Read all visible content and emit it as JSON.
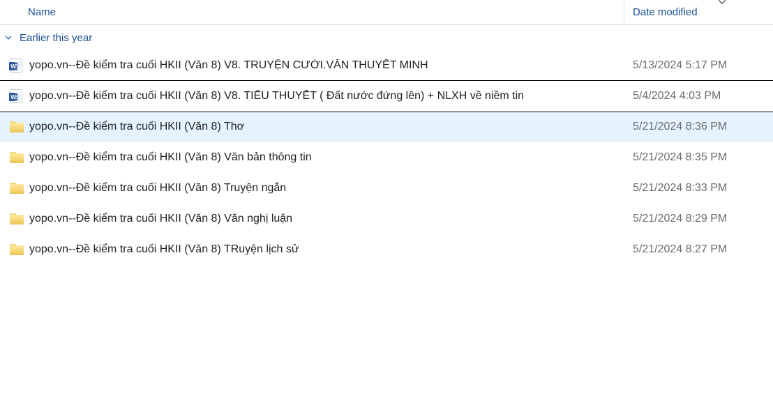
{
  "columns": {
    "name": "Name",
    "date": "Date modified"
  },
  "group": {
    "label": "Earlier this year"
  },
  "items": [
    {
      "type": "word",
      "name": "yopo.vn--Đề kiểm tra cuối HKII (Văn 8) V8.  TRUYỆN CƯỜI.VĂN THUYẾT MINH",
      "date": "5/13/2024 5:17 PM",
      "state": ""
    },
    {
      "type": "word",
      "name": "yopo.vn--Đề kiểm tra cuối HKII (Văn 8)  V8. TIỂU THUYẾT ( Đất nước đứng lên) + NLXH về niềm tin",
      "date": "5/4/2024 4:03 PM",
      "state": "selected"
    },
    {
      "type": "folder",
      "name": "yopo.vn--Đề kiểm tra cuối HKII (Văn 8)  Thơ",
      "date": "5/21/2024 8:36 PM",
      "state": "hover"
    },
    {
      "type": "folder",
      "name": "yopo.vn--Đề kiểm tra cuối HKII (Văn 8)  Văn bản thông tin",
      "date": "5/21/2024 8:35 PM",
      "state": ""
    },
    {
      "type": "folder",
      "name": "yopo.vn--Đề kiểm tra cuối HKII (Văn 8)  Truyện ngắn",
      "date": "5/21/2024 8:33 PM",
      "state": ""
    },
    {
      "type": "folder",
      "name": "yopo.vn--Đề kiểm tra cuối HKII (Văn 8)  Văn nghị luận",
      "date": "5/21/2024 8:29 PM",
      "state": ""
    },
    {
      "type": "folder",
      "name": "yopo.vn--Đề kiểm tra cuối HKII (Văn 8)  TRuyện lịch sử",
      "date": "5/21/2024 8:27 PM",
      "state": ""
    }
  ]
}
